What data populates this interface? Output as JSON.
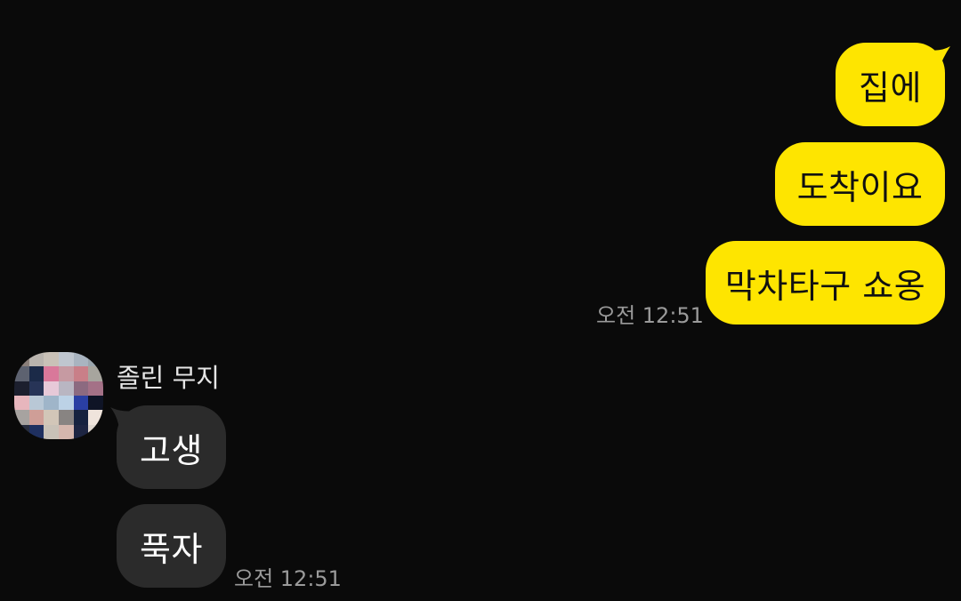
{
  "outgoing": {
    "messages": [
      {
        "text": "집에"
      },
      {
        "text": "도착이요"
      },
      {
        "text": "막차타구 쇼옹"
      }
    ],
    "time": "오전 12:51",
    "bubble_color": "#fee500"
  },
  "incoming": {
    "sender_name": "졸린 무지",
    "avatar_icon": "pixelated-avatar-icon",
    "messages": [
      {
        "text": "고생"
      },
      {
        "text": "푹자"
      }
    ],
    "time": "오전 12:51",
    "bubble_color": "#2b2b2b"
  },
  "background_color": "#0a0a0a"
}
